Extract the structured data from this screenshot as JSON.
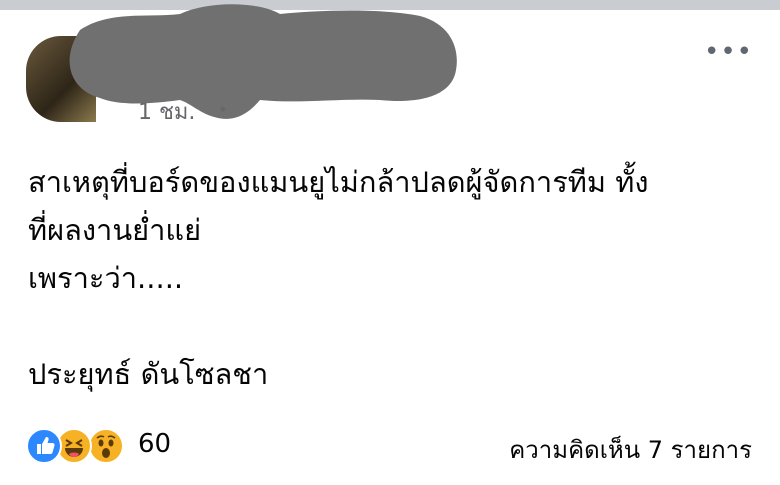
{
  "post": {
    "time_label": "1 ชม.",
    "privacy_icon": "globe-icon",
    "more_label": "•••",
    "body_lines": [
      "สาเหตุที่บอร์ดของแมนยูไม่กล้าปลดผู้จัดการทีม ทั้ง",
      "ที่ผลงานย่ำแย่",
      "เพราะว่า.....",
      "ประยุทธ์ ดันโซลชา"
    ]
  },
  "reactions": {
    "icons": [
      "like-icon",
      "haha-icon",
      "wow-icon"
    ],
    "count": "60"
  },
  "comments": {
    "label": "ความคิดเห็น 7 รายการ"
  },
  "colors": {
    "text": "#050505",
    "meta": "#65676b",
    "like": "#2d88ff",
    "emoji_yellow": "#f7b125",
    "redaction": "#707070"
  }
}
